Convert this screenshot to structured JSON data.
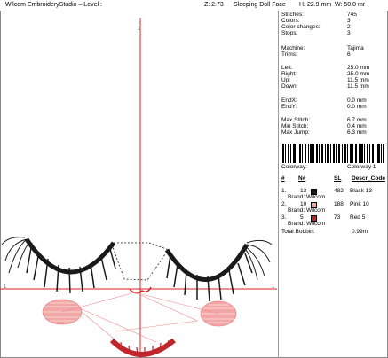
{
  "header": {
    "title": "Wilcom EmbroideryStudio – Level :",
    "zoom": "Z: 2.73",
    "design": "Sleeping Doll Face",
    "height": "H: 22.9 mm",
    "width": "W: 50.0 mr"
  },
  "stats": {
    "stitches_label": "Stitches:",
    "stitches": "745",
    "colors_label": "Colors:",
    "colors": "3",
    "color_changes_label": "Color changes:",
    "color_changes": "2",
    "stops_label": "Stops:",
    "stops": "3",
    "machine_label": "Machine:",
    "machine": "Tajima",
    "trims_label": "Trims:",
    "trims": "6",
    "left_label": "Left:",
    "left": "25.0 mm",
    "right_label": "Right:",
    "right": "25.0 mm",
    "up_label": "Up:",
    "up": "11.5 mm",
    "down_label": "Down:",
    "down": "11.5 mm",
    "endx_label": "EndX:",
    "endx": "0.0 mm",
    "endy_label": "EndY:",
    "endy": "0.0 mm",
    "max_stitch_label": "Max Stitch:",
    "max_stitch": "6.7 mm",
    "min_stitch_label": "Min Stitch:",
    "min_stitch": "0.4 mm",
    "max_jump_label": "Max Jump:",
    "max_jump": "6.3 mm",
    "colorway_label": "Colorway:",
    "colorway": "Colorway 1"
  },
  "table": {
    "col_num": "#",
    "col_n": "N#",
    "col_sl": "SL",
    "col_desc": "Descr_Code",
    "rows": [
      {
        "idx": "1.",
        "n": "13",
        "sl": "482",
        "desc": "Black 13",
        "brand": "Brand: Wilcom",
        "color": "#1a1a1a"
      },
      {
        "idx": "2.",
        "n": "10",
        "sl": "188",
        "desc": "Pink 10",
        "brand": "Brand: Wilcom",
        "color": "#f2a7a7"
      },
      {
        "idx": "3.",
        "n": "5",
        "sl": "73",
        "desc": "Red 5",
        "brand": "Brand: Wilcom",
        "color": "#c0262c"
      }
    ],
    "total_label": "Total Bobbin:",
    "total": "0.99m"
  },
  "axis_marks": {
    "top": "1",
    "left": "1",
    "right": "1"
  },
  "colors": {
    "axis": "#d8222a",
    "thread_black": "#1a1a1a",
    "thread_pink": "#f2a7a7",
    "thread_red": "#c0262c"
  }
}
